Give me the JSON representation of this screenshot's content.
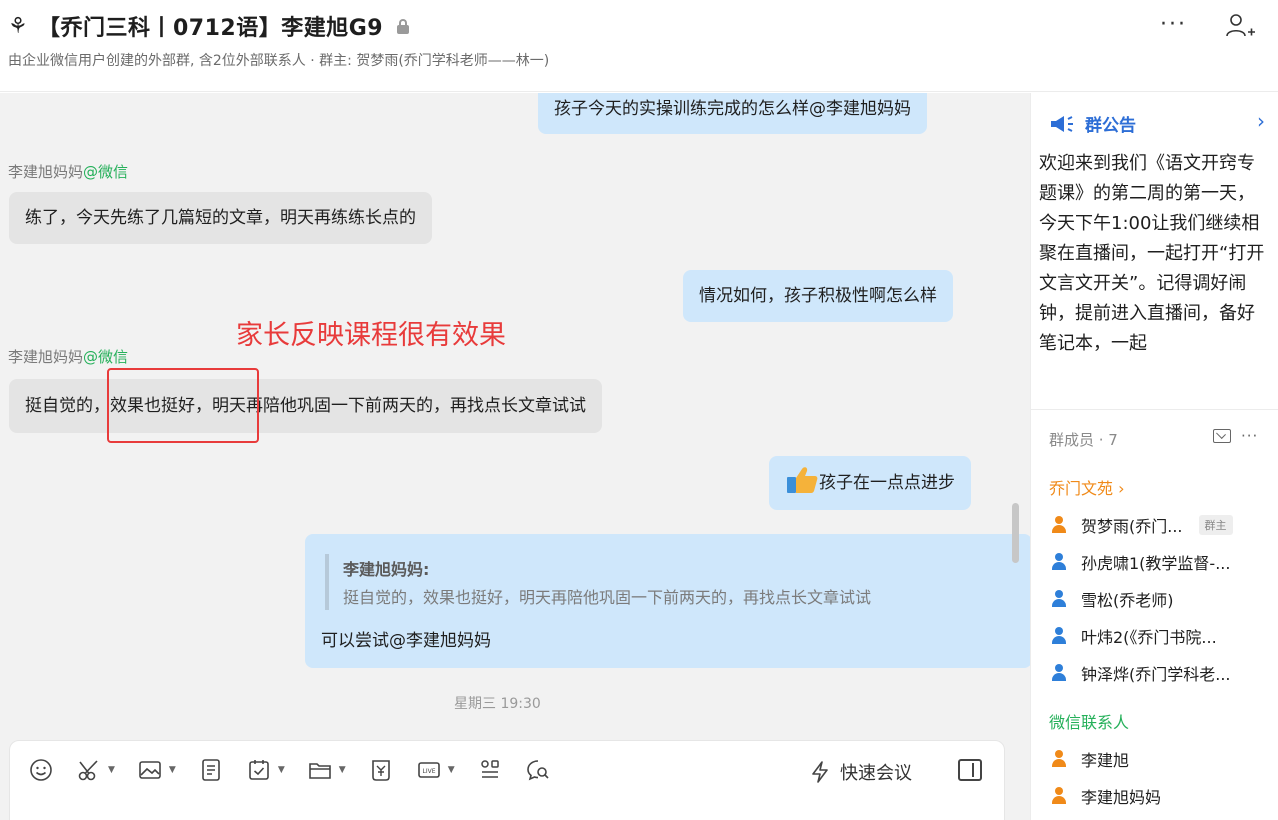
{
  "header": {
    "title": "【乔门三科丨0712语】李建旭G9",
    "subtitle": "由企业微信用户创建的外部群, 含2位外部联系人 · 群主: 贺梦雨(乔门学科老师——林一)",
    "more_label": "···"
  },
  "chat": {
    "messages": [
      {
        "text": "孩子今天的实操训练完成的怎么样@李建旭妈妈"
      },
      {
        "sender": "李建旭妈妈",
        "via": "@微信",
        "text": "练了，今天先练了几篇短的文章，明天再练练长点的"
      },
      {
        "text": "情况如何，孩子积极性啊怎么样"
      },
      {
        "sender": "李建旭妈妈",
        "via": "@微信",
        "text": "挺自觉的，效果也挺好，明天再陪他巩固一下前两天的，再找点长文章试试"
      },
      {
        "text": "孩子在一点点进步"
      },
      {
        "quote_name": "李建旭妈妈:",
        "quote_text": "挺自觉的，效果也挺好，明天再陪他巩固一下前两天的，再找点长文章试试",
        "text": "可以尝试@李建旭妈妈"
      }
    ],
    "annotation": "家长反映课程很有效果",
    "timestamp": "星期三 19:30"
  },
  "composer": {
    "quick_meeting_label": "快速会议"
  },
  "sidebar": {
    "announcement_title": "群公告",
    "announcement_body": "欢迎来到我们《语文开窍专题课》的第二周的第一天，今天下午1:00让我们继续相聚在直播间，一起打开“打开文言文开关”。记得调好闹钟，提前进入直播间，备好笔记本，一起",
    "members_title": "群成员 · 7",
    "members_more": "···",
    "group_a_label": "乔门文苑 ›",
    "group_a_members": [
      {
        "name": "贺梦雨(乔门...",
        "tag": "群主"
      },
      {
        "name": "孙虎啸1(教学监督-..."
      },
      {
        "name": "雪松(乔老师)"
      },
      {
        "name": "叶炜2(《乔门书院..."
      },
      {
        "name": "钟泽烨(乔门学科老..."
      }
    ],
    "group_b_label": "微信联系人",
    "group_b_members": [
      {
        "name": "李建旭"
      },
      {
        "name": "李建旭妈妈"
      }
    ]
  },
  "colors": {
    "accent_blue": "#2d6ed6",
    "outgoing_bubble": "#cfe7fb",
    "incoming_bubble": "#e4e4e4",
    "wechat_green": "#25b05a",
    "annotation_red": "#e83b3b",
    "group_orange": "#f08a19"
  }
}
